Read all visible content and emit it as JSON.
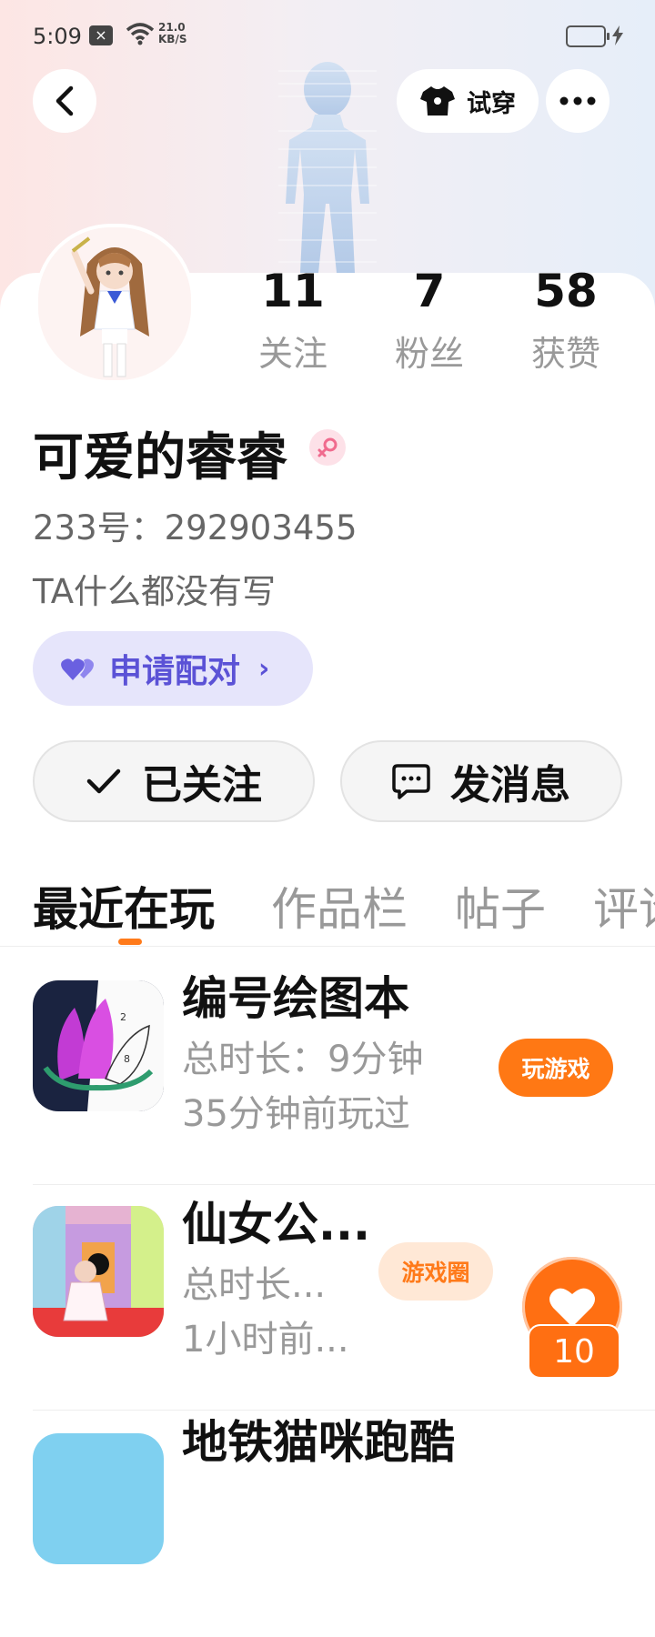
{
  "status_bar": {
    "time": "5:09",
    "net_speed_value": "21.0",
    "net_speed_unit": "KB/S"
  },
  "header": {
    "try_on_label": "试穿"
  },
  "profile": {
    "stats": [
      {
        "value": "11",
        "label": "关注"
      },
      {
        "value": "7",
        "label": "粉丝"
      },
      {
        "value": "58",
        "label": "获赞"
      }
    ],
    "name": "可爱的睿睿",
    "gender": "female",
    "uid": "233号：292903455",
    "bio": "TA什么都没有写",
    "pair_label": "申请配对"
  },
  "actions": {
    "follow_label": "已关注",
    "message_label": "发消息"
  },
  "tabs": [
    "最近在玩",
    "作品栏",
    "帖子",
    "评论"
  ],
  "games": [
    {
      "title": "编号绘图本",
      "duration": "总时长：9分钟",
      "last_played": "35分钟前玩过",
      "button": "玩游戏"
    },
    {
      "title": "仙女公...",
      "duration": "总时长...",
      "last_played": "1小时前...",
      "circle_tag": "游戏圈"
    },
    {
      "title": "地铁猫咪跑酷"
    }
  ],
  "like_count": "10",
  "colors": {
    "accent": "#ff7a1a",
    "pair": "#5b52d6"
  }
}
